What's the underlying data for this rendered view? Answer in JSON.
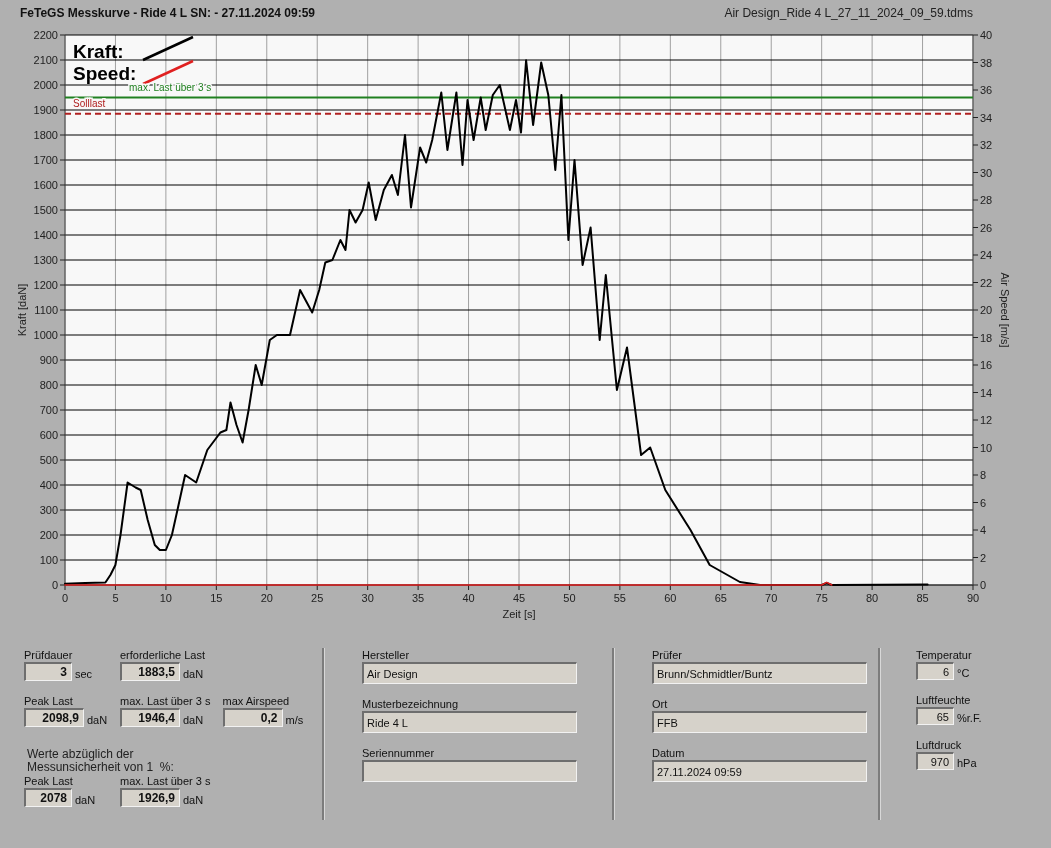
{
  "header": {
    "title": "FeTeGS Messkurve - Ride 4 L  SN:  - 27.11.2024 09:59",
    "file_name": "Air Design_Ride 4 L_27_11_2024_09_59.tdms"
  },
  "plot": {
    "chart_data": {
      "type": "line",
      "xlabel": "Zeit [s]",
      "ylabel": "Kraft [daN]",
      "y2label": "Air Speed [m/s]",
      "xlim": [
        0,
        90
      ],
      "ylim": [
        0,
        2200
      ],
      "y2lim": [
        0,
        40
      ],
      "xticks": [
        0,
        5,
        10,
        15,
        20,
        25,
        30,
        35,
        40,
        45,
        50,
        55,
        60,
        65,
        70,
        75,
        80,
        85,
        90
      ],
      "yticks": [
        0,
        100,
        200,
        300,
        400,
        500,
        600,
        700,
        800,
        900,
        1000,
        1100,
        1200,
        1300,
        1400,
        1500,
        1600,
        1700,
        1800,
        1900,
        2000,
        2100,
        2200
      ],
      "y2ticks": [
        0,
        2,
        4,
        6,
        8,
        10,
        12,
        14,
        16,
        18,
        20,
        22,
        24,
        26,
        28,
        30,
        32,
        34,
        36,
        38,
        40
      ],
      "x": [
        0,
        2,
        4,
        4.5,
        5,
        5.5,
        6.2,
        7,
        7.5,
        8.2,
        8.9,
        9.4,
        10,
        10.6,
        11.2,
        11.9,
        13,
        14.1,
        15.4,
        16,
        16.4,
        17,
        17.6,
        18.2,
        18.9,
        19.5,
        20.3,
        21,
        22.3,
        23.3,
        24.5,
        25.2,
        25.8,
        26.5,
        27.3,
        27.8,
        28.2,
        28.8,
        29.5,
        30.1,
        30.8,
        31.6,
        32.4,
        33,
        33.7,
        34.3,
        35.2,
        35.8,
        36.4,
        37.3,
        37.9,
        38.8,
        39.4,
        39.9,
        40.5,
        41.2,
        41.7,
        42.4,
        43.1,
        44.1,
        44.7,
        45.2,
        45.7,
        46.4,
        47.2,
        47.9,
        48.6,
        49.2,
        49.9,
        50.5,
        51.3,
        52.1,
        53,
        53.6,
        54.7,
        55.7,
        57.1,
        58,
        59.5,
        62,
        63.9,
        66.9,
        68.9,
        75,
        75.5,
        76,
        85.5
      ],
      "series": [
        {
          "name": "Kraft:",
          "color": "#000000",
          "values": [
            5,
            8,
            10,
            40,
            80,
            200,
            410,
            390,
            380,
            260,
            160,
            140,
            140,
            200,
            310,
            440,
            410,
            540,
            610,
            620,
            730,
            640,
            570,
            700,
            880,
            800,
            980,
            1000,
            1000,
            1180,
            1090,
            1180,
            1290,
            1300,
            1380,
            1340,
            1500,
            1450,
            1500,
            1610,
            1460,
            1580,
            1640,
            1560,
            1800,
            1510,
            1750,
            1690,
            1780,
            1970,
            1740,
            1970,
            1680,
            1940,
            1780,
            1950,
            1820,
            1960,
            2000,
            1820,
            1940,
            1810,
            2099,
            1840,
            2090,
            1960,
            1660,
            1960,
            1380,
            1700,
            1280,
            1430,
            980,
            1240,
            780,
            950,
            520,
            550,
            380,
            220,
            80,
            12,
            0,
            0,
            8,
            0,
            2
          ]
        },
        {
          "name": "Speed:",
          "color": "#e02020",
          "axis": "y2",
          "values": [
            0,
            0,
            0,
            0,
            0,
            0,
            0,
            0,
            0,
            0,
            0,
            0,
            0,
            0,
            0,
            0,
            0,
            0,
            0,
            0,
            0,
            0,
            0,
            0,
            0,
            0,
            0,
            0,
            0,
            0,
            0,
            0,
            0,
            0,
            0,
            0,
            0,
            0,
            0,
            0,
            0,
            0,
            0,
            0,
            0,
            0,
            0,
            0,
            0,
            0,
            0,
            0,
            0,
            0,
            0,
            0,
            0,
            0,
            0,
            0,
            0,
            0,
            0,
            0,
            0,
            0,
            0,
            0,
            0,
            0,
            0,
            0,
            0,
            0,
            0,
            0,
            0,
            0,
            0,
            0,
            0,
            0,
            0,
            0,
            0.2,
            0,
            null
          ]
        }
      ],
      "grid": true,
      "legend": "upper left",
      "ref_lines": [
        {
          "axis": "y",
          "value": 1950,
          "label": "max. Last über  3 s",
          "color": "#208020"
        },
        {
          "axis": "y",
          "value": 1885,
          "label": "Solllast",
          "color": "#b02020"
        }
      ]
    }
  },
  "test_values": {
    "rows": [
      [
        {
          "label": "Prüfdauer",
          "value": "3",
          "unit": "sec"
        },
        {
          "label": "erforderliche Last",
          "value": "1883,5",
          "unit": "daN"
        }
      ],
      [
        {
          "label": "Peak Last",
          "value": "2098,9",
          "unit": "daN"
        },
        {
          "label": "max. Last über  3 s",
          "value": "1946,4",
          "unit": "daN"
        },
        {
          "label": "max Airspeed",
          "value": "0,2",
          "unit": "m/s"
        }
      ]
    ],
    "correction_note": "Werte abzüglich der Messunsicherheit von 1  %:",
    "corrected_rows": [
      [
        {
          "label": "Peak Last",
          "value": "2078",
          "unit": "daN"
        },
        {
          "label": "max. Last über  3 s",
          "value": "1926,9",
          "unit": "daN"
        }
      ]
    ]
  },
  "product_info": [
    {
      "label": "Hersteller",
      "value": "Air Design"
    },
    {
      "label": "Musterbezeichnung",
      "value": "Ride 4 L"
    },
    {
      "label": "Seriennummer"
    }
  ],
  "tester_info": [
    {
      "label": "Prüfer",
      "value": "Brunn/Schmidtler/Buntz"
    },
    {
      "label": "Ort",
      "value": "FFB"
    },
    {
      "label": "Datum",
      "value": "27.11.2024 09:59"
    }
  ],
  "conditions": [
    {
      "label": "Temperatur",
      "value": "6",
      "unit": "°C"
    },
    {
      "label": "Luftfeuchte",
      "value": "65",
      "unit": "%r.F."
    },
    {
      "label": "Luftdruck",
      "value": "970",
      "unit": "hPa"
    }
  ]
}
